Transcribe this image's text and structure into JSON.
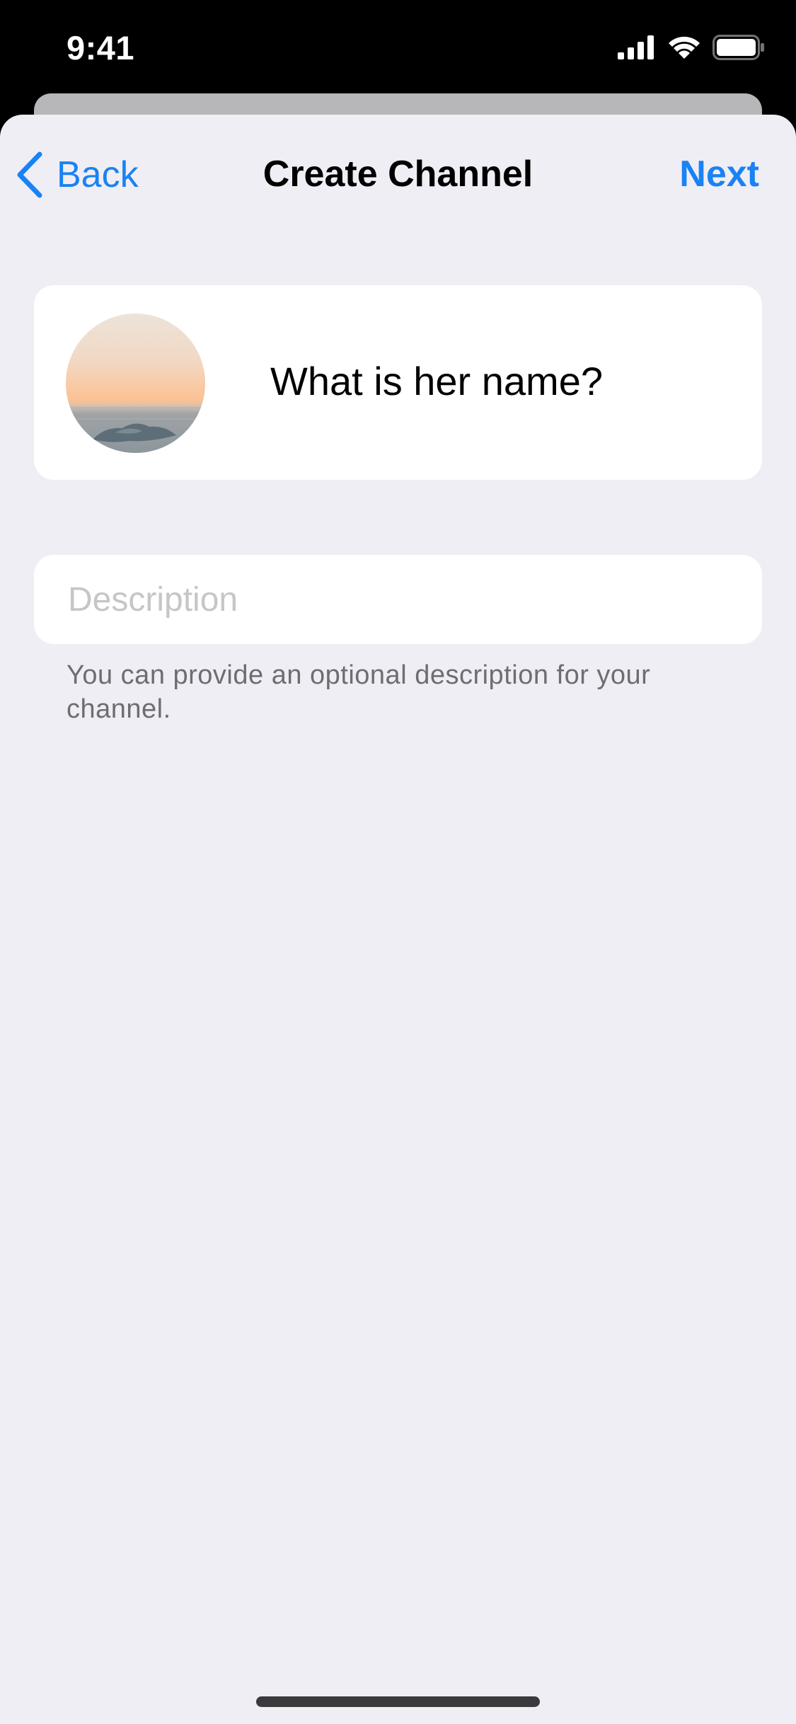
{
  "status_bar": {
    "time": "9:41",
    "icons": [
      "cellular-signal-icon",
      "wifi-icon",
      "battery-icon"
    ]
  },
  "nav": {
    "back_label": "Back",
    "title": "Create Channel",
    "next_label": "Next"
  },
  "channel": {
    "name_value": "What is her name?",
    "description_placeholder": "Description",
    "description_value": "",
    "description_hint": "You can provide an optional description for your channel."
  },
  "colors": {
    "accent": "#1a82f3",
    "background": "#efeef4",
    "card": "#ffffff",
    "hint_text": "#6d6d72",
    "placeholder": "#c6c6c9"
  }
}
